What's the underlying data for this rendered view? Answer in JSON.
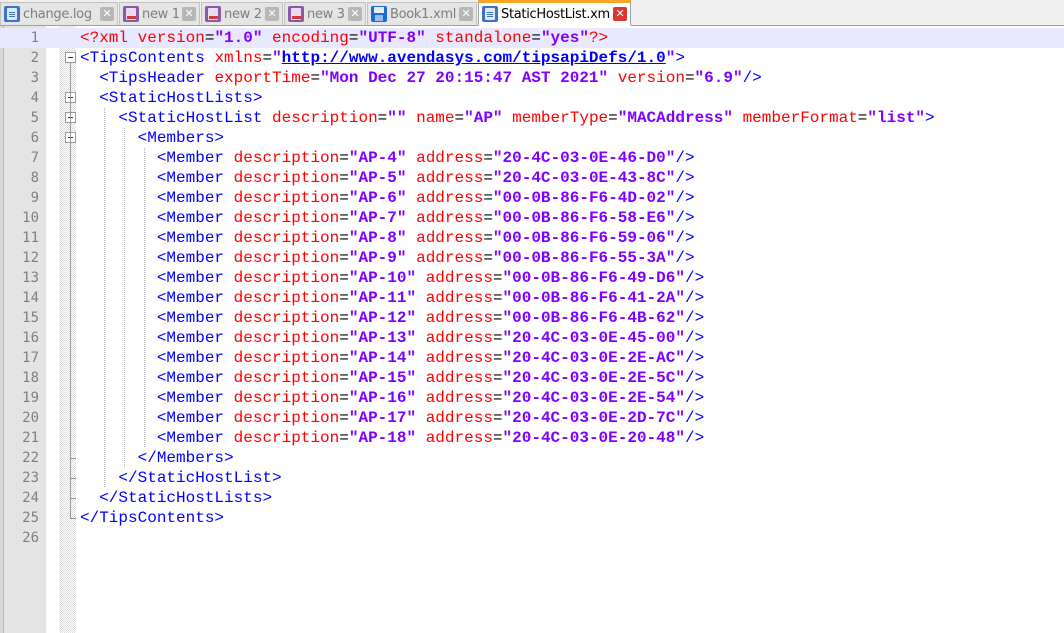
{
  "tabs": [
    {
      "label": "change.log",
      "icon": "plain-file-icon",
      "active": false
    },
    {
      "label": "new 1",
      "icon": "unsaved-file-icon",
      "active": false
    },
    {
      "label": "new 2",
      "icon": "unsaved-file-icon",
      "active": false
    },
    {
      "label": "new 3",
      "icon": "unsaved-file-icon",
      "active": false
    },
    {
      "label": "Book1.xml",
      "icon": "saved-file-icon",
      "active": false
    },
    {
      "label": "StaticHostList.xml",
      "icon": "plain-file-icon",
      "active": true
    }
  ],
  "close_glyph": "✕",
  "colors": {
    "tag": "#0000ff",
    "attribute": "#ff0000",
    "value": "#8000ff",
    "current_line": "#e8e8ff",
    "active_tab_accent": "#f9a52a"
  },
  "lines": [
    {
      "n": "1",
      "text": "<?xml version=\"1.0\" encoding=\"UTF-8\" standalone=\"yes\"?>"
    },
    {
      "n": "2",
      "text": "<TipsContents xmlns=\"http://www.avendasys.com/tipsapiDefs/1.0\">"
    },
    {
      "n": "3",
      "text": "  <TipsHeader exportTime=\"Mon Dec 27 20:15:47 AST 2021\" version=\"6.9\"/>"
    },
    {
      "n": "4",
      "text": "  <StaticHostLists>"
    },
    {
      "n": "5",
      "text": "    <StaticHostList description=\"\" name=\"AP\" memberType=\"MACAddress\" memberFormat=\"list\">"
    },
    {
      "n": "6",
      "text": "      <Members>"
    },
    {
      "n": "7",
      "text": "        <Member description=\"AP-4\" address=\"20-4C-03-0E-46-D0\"/>"
    },
    {
      "n": "8",
      "text": "        <Member description=\"AP-5\" address=\"20-4C-03-0E-43-8C\"/>"
    },
    {
      "n": "9",
      "text": "        <Member description=\"AP-6\" address=\"00-0B-86-F6-4D-02\"/>"
    },
    {
      "n": "10",
      "text": "        <Member description=\"AP-7\" address=\"00-0B-86-F6-58-E6\"/>"
    },
    {
      "n": "11",
      "text": "        <Member description=\"AP-8\" address=\"00-0B-86-F6-59-06\"/>"
    },
    {
      "n": "12",
      "text": "        <Member description=\"AP-9\" address=\"00-0B-86-F6-55-3A\"/>"
    },
    {
      "n": "13",
      "text": "        <Member description=\"AP-10\" address=\"00-0B-86-F6-49-D6\"/>"
    },
    {
      "n": "14",
      "text": "        <Member description=\"AP-11\" address=\"00-0B-86-F6-41-2A\"/>"
    },
    {
      "n": "15",
      "text": "        <Member description=\"AP-12\" address=\"00-0B-86-F6-4B-62\"/>"
    },
    {
      "n": "16",
      "text": "        <Member description=\"AP-13\" address=\"20-4C-03-0E-45-00\"/>"
    },
    {
      "n": "17",
      "text": "        <Member description=\"AP-14\" address=\"20-4C-03-0E-2E-AC\"/>"
    },
    {
      "n": "18",
      "text": "        <Member description=\"AP-15\" address=\"20-4C-03-0E-2E-5C\"/>"
    },
    {
      "n": "19",
      "text": "        <Member description=\"AP-16\" address=\"20-4C-03-0E-2E-54\"/>"
    },
    {
      "n": "20",
      "text": "        <Member description=\"AP-17\" address=\"20-4C-03-0E-2D-7C\"/>"
    },
    {
      "n": "21",
      "text": "        <Member description=\"AP-18\" address=\"20-4C-03-0E-20-48\"/>"
    },
    {
      "n": "22",
      "text": "      </Members>"
    },
    {
      "n": "23",
      "text": "    </StaticHostList>"
    },
    {
      "n": "24",
      "text": "  </StaticHostLists>"
    },
    {
      "n": "25",
      "text": "</TipsContents>"
    },
    {
      "n": "26",
      "text": ""
    }
  ]
}
